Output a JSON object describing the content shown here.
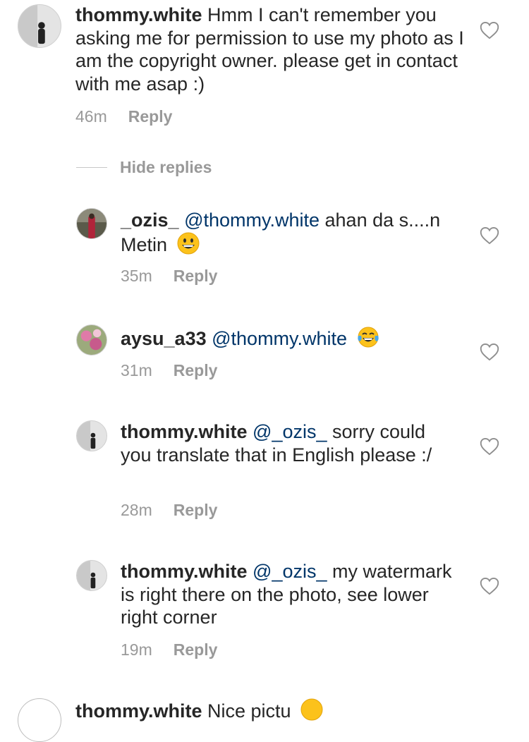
{
  "comments": [
    {
      "username": "thommy.white",
      "text": "Hmm I can't remember you asking me for permission to use my photo as I am the copyright owner. please get in contact with me asap :)",
      "time": "46m",
      "reply_label": "Reply"
    }
  ],
  "hide_replies_label": "Hide replies",
  "replies": [
    {
      "username": "_ozis_",
      "mention": "@thommy.white",
      "text": " ahan da s....n Metin",
      "emoji": "grinning-face",
      "time": "35m",
      "reply_label": "Reply"
    },
    {
      "username": "aysu_a33",
      "mention": "@thommy.white",
      "text": "",
      "emoji": "face-with-tears-of-joy",
      "time": "31m",
      "reply_label": "Reply"
    },
    {
      "username": "thommy.white",
      "mention": "@_ozis_",
      "text": "sorry could you translate that in English please :/",
      "time": "28m",
      "reply_label": "Reply"
    },
    {
      "username": "thommy.white",
      "mention": "@_ozis_",
      "text": "my watermark is right there on the photo, see lower right corner",
      "time": "19m",
      "reply_label": "Reply"
    }
  ],
  "next_comment_partial": {
    "username": "thommy.white",
    "text": "Nice pictu",
    "emoji": "grinning-face"
  },
  "colors": {
    "text": "#262626",
    "mention": "#003569",
    "meta": "#999999"
  }
}
